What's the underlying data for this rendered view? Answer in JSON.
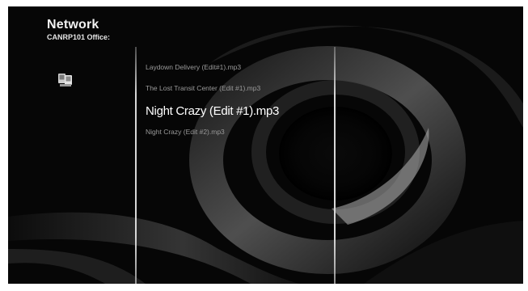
{
  "header": {
    "title": "Network",
    "subtitle": "CANRP101 Office:"
  },
  "source_icon": "network-computers-icon",
  "files": [
    {
      "label": "Laydown Delivery (Edit#1).mp3",
      "selected": false
    },
    {
      "label": "The Lost Transit Center (Edit #1).mp3",
      "selected": false
    },
    {
      "label": "Night Crazy (Edit #1).mp3",
      "selected": true
    },
    {
      "label": "Night Crazy (Edit #2).mp3",
      "selected": false
    }
  ],
  "colors": {
    "background": "#060606",
    "selected_text": "#ffffff",
    "unselected_text": "#9a9a9a",
    "divider": "#d8d8d8"
  }
}
